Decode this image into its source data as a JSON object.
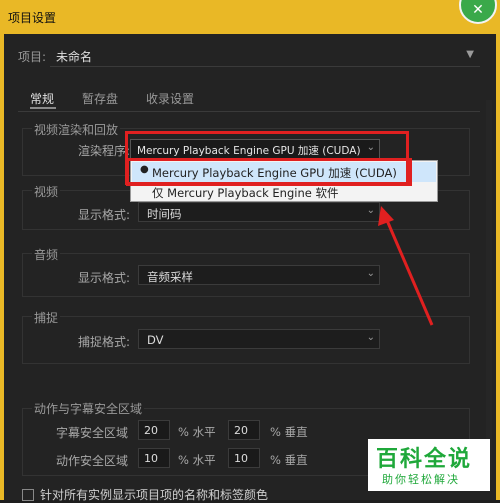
{
  "window": {
    "title": "项目设置"
  },
  "project": {
    "label": "项目:",
    "value": "未命名"
  },
  "tabs": [
    {
      "label": "常规",
      "active": true
    },
    {
      "label": "暂存盘",
      "active": false
    },
    {
      "label": "收录设置",
      "active": false
    }
  ],
  "video_render": {
    "title": "视频渲染和回放",
    "renderer_label": "渲染程序:",
    "renderer_value": "Mercury Playback Engine GPU 加速 (CUDA)",
    "menu_options": [
      {
        "label": "Mercury Playback Engine GPU 加速 (CUDA)",
        "selected": true
      },
      {
        "label": "仅 Mercury Playback Engine 软件",
        "selected": false
      }
    ]
  },
  "video": {
    "title": "视频",
    "format_label": "显示格式:",
    "format_value": "时间码"
  },
  "audio": {
    "title": "音频",
    "format_label": "显示格式:",
    "format_value": "音频采样"
  },
  "capture": {
    "title": "捕捉",
    "format_label": "捕捉格式:",
    "format_value": "DV"
  },
  "safe_areas": {
    "title": "动作与字幕安全区域",
    "title_safe_label": "字幕安全区域",
    "title_h": "20",
    "title_v": "20",
    "action_safe_label": "动作安全区域",
    "action_h": "10",
    "action_v": "10",
    "h_unit": "% 水平",
    "v_unit": "% 垂直"
  },
  "checkbox_label": "针对所有实例显示项目项的名称和标签颜色",
  "watermark": {
    "big": "百科全说",
    "small": "助你轻松解决"
  },
  "colors": {
    "accent": "#e9b826",
    "highlight": "#e02020",
    "brand": "#1fa83a"
  }
}
